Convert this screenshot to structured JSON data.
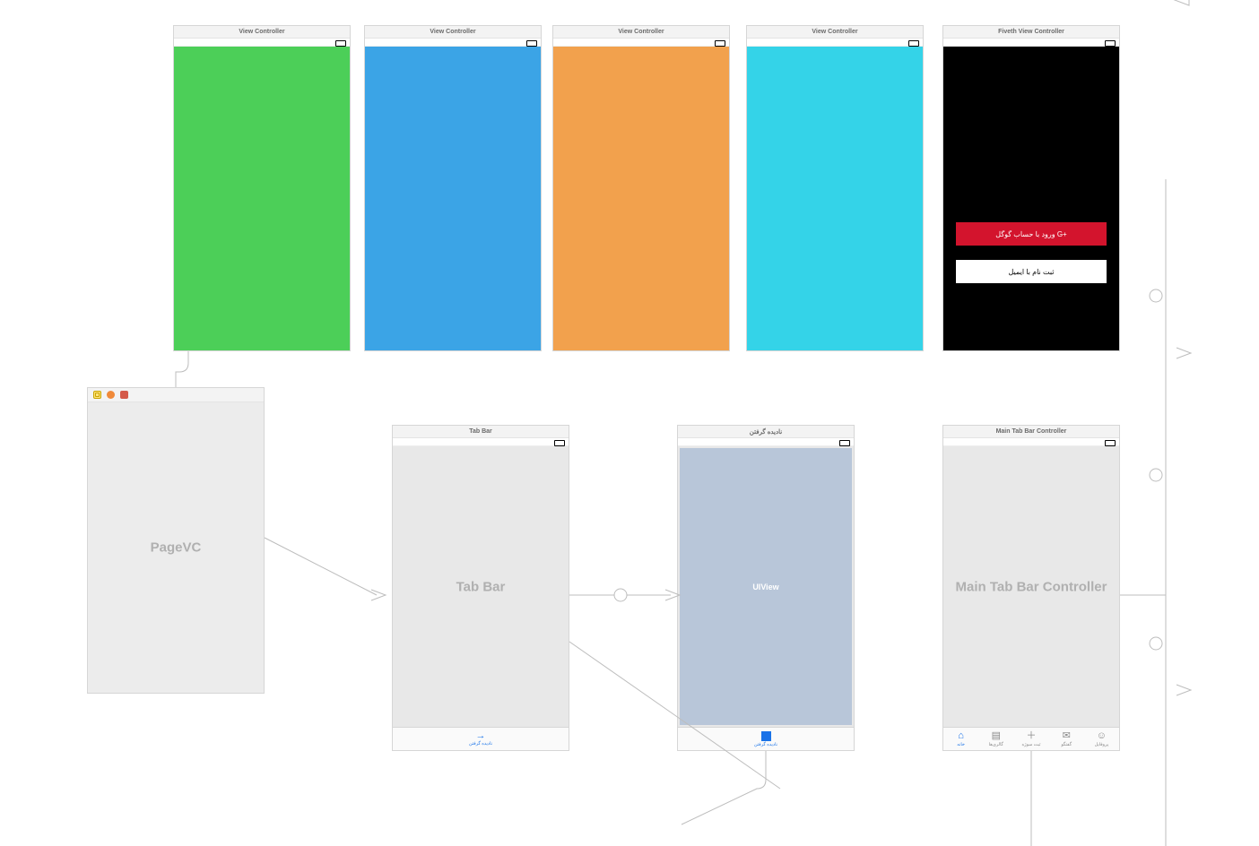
{
  "top": [
    {
      "title": "View Controller"
    },
    {
      "title": "View Controller"
    },
    {
      "title": "View Controller"
    },
    {
      "title": "View Controller"
    },
    {
      "title": "Fiveth View Controller",
      "google_label": "ورود با حساب گوگل  G+",
      "email_label": "ثبت نام با ایمیل"
    }
  ],
  "pagevc": {
    "label": "PageVC"
  },
  "tabbar": {
    "title": "Tab Bar",
    "center": "Tab Bar",
    "tab_icon": "arrow-right-icon",
    "tab_label": "نادیده گرفتن"
  },
  "detail": {
    "title": "نادیده گرفتن",
    "uiview": "UIView",
    "tab_label": "نادیده گرفتن"
  },
  "maintab": {
    "title": "Main Tab Bar Controller",
    "center": "Main Tab Bar Controller",
    "items": [
      {
        "icon": "⌂",
        "label": "خانه",
        "name": "tab-home",
        "active": true
      },
      {
        "icon": "▤",
        "label": "گالری‌ها",
        "name": "tab-gallery",
        "active": false
      },
      {
        "icon": "＋",
        "label": "ثبت سوژه",
        "name": "tab-add",
        "active": false
      },
      {
        "icon": "✉",
        "label": "گفتگو",
        "name": "tab-chat",
        "active": false
      },
      {
        "icon": "☺",
        "label": "پروفایل",
        "name": "tab-profile",
        "active": false
      }
    ]
  }
}
